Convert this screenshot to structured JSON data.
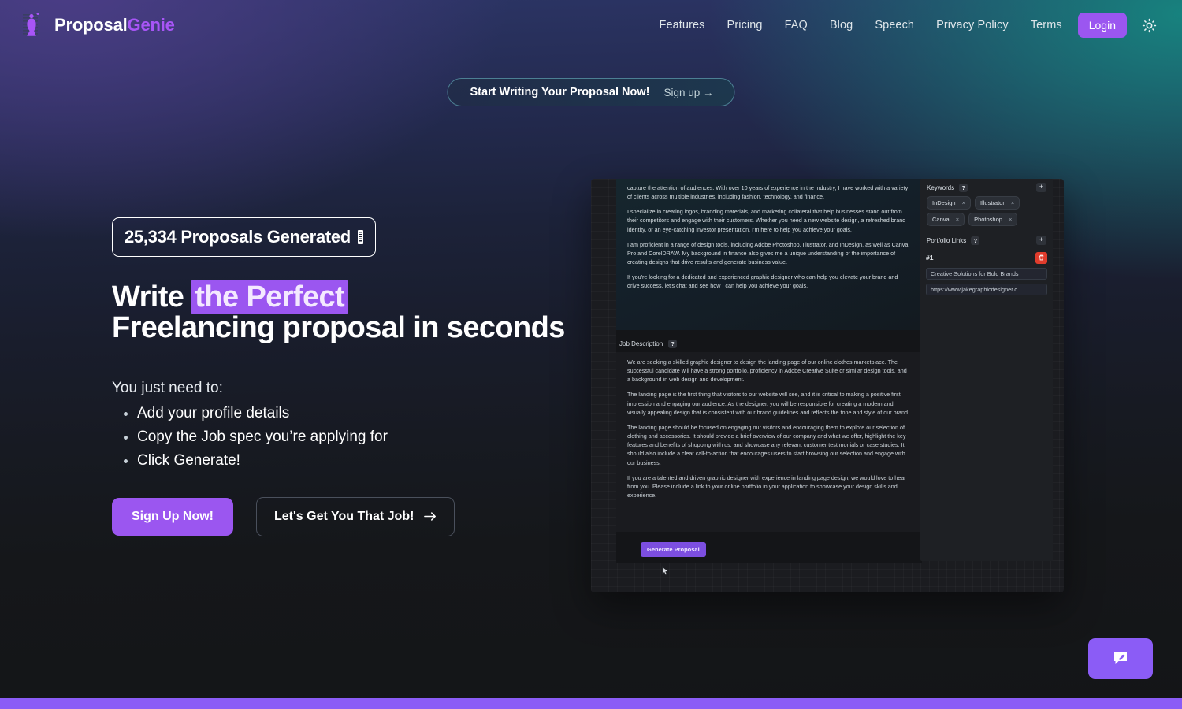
{
  "brand": {
    "word1": "Proposal",
    "word2": "Genie",
    "icon": "genie-lamp-icon"
  },
  "nav": {
    "links": [
      {
        "label": "Features"
      },
      {
        "label": "Pricing"
      },
      {
        "label": "FAQ"
      },
      {
        "label": "Blog"
      },
      {
        "label": "Speech"
      },
      {
        "label": "Privacy Policy"
      },
      {
        "label": "Terms"
      }
    ],
    "login_label": "Login",
    "theme_icon": "sun-icon"
  },
  "announcement": {
    "main": "Start Writing Your Proposal Now!",
    "cta": "Sign up →"
  },
  "hero": {
    "counter": {
      "value": "25,334",
      "label": "Proposals Generated",
      "icon": "counter-bar-icon"
    },
    "headline": {
      "line1_pre": "Write ",
      "line1_highlight": "the Perfect",
      "line2": "Freelancing proposal in seconds"
    },
    "need_title": "You just need to:",
    "need_items": [
      "Add your profile details",
      "Copy the Job spec you’re applying for",
      "Click Generate!"
    ],
    "primary_cta": "Sign Up Now!",
    "secondary_cta": "Let's Get You That Job!"
  },
  "app_shot": {
    "profile_paragraphs": [
      "capture the attention of audiences. With over 10 years of experience in the industry, I have worked with a variety of clients across multiple industries, including fashion, technology, and finance.",
      "I specialize in creating logos, branding materials, and marketing collateral that help businesses stand out from their competitors and engage with their customers. Whether you need a new website design, a refreshed brand identity, or an eye-catching investor presentation, I'm here to help you achieve your goals.",
      "I am proficient in a range of design tools, including Adobe Photoshop, Illustrator, and InDesign, as well as Canva Pro and CorelDRAW. My background in finance also gives me a unique understanding of the importance of creating designs that drive results and generate business value.",
      "If you're looking for a dedicated and experienced graphic designer who can help you elevate your brand and drive success, let's chat and see how I can help you achieve your goals."
    ],
    "job_description_label": "Job Description",
    "help_glyph": "?",
    "job_description_paragraphs": [
      "We are seeking a skilled graphic designer to design the landing page of our online clothes marketplace. The successful candidate will have a strong portfolio, proficiency in Adobe Creative Suite or similar design tools, and a background in web design and development.",
      "The landing page is the first thing that visitors to our website will see, and it is critical to making a positive first impression and engaging our audience. As the designer, you will be responsible for creating a modern and visually appealing design that is consistent with our brand guidelines and reflects the tone and style of our brand.",
      "The landing page should be focused on engaging our visitors and encouraging them to explore our selection of clothing and accessories. It should provide a brief overview of our company and what we offer, highlight the key features and benefits of shopping with us, and showcase any relevant customer testimonials or case studies. It should also include a clear call-to-action that encourages users to start browsing our selection and engage with our business.",
      "If you are a talented and driven graphic designer with experience in landing page design, we would love to hear from you. Please include a link to your online portfolio in your application to showcase your design skills and experience."
    ],
    "generate_button": "Generate Proposal",
    "sidebar": {
      "keywords_label": "Keywords",
      "keywords_add": "+",
      "keywords": [
        {
          "label": "InDesign",
          "remove": "×"
        },
        {
          "label": "Illustrator",
          "remove": "×"
        },
        {
          "label": "Canva",
          "remove": "×"
        },
        {
          "label": "Photoshop",
          "remove": "×"
        }
      ],
      "portfolio_label": "Portfolio Links",
      "portfolio_add": "+",
      "portfolio_index": "#1",
      "portfolio_title": "Creative Solutions for Bold Brands",
      "portfolio_url": "https://www.jakegraphicdesigner.c"
    }
  },
  "chat": {
    "icon": "chat-edit-icon"
  },
  "colors": {
    "accent_purple": "#9b56f0",
    "fab_purple": "#8b5cf6",
    "delete_red": "#e03c2c",
    "announce_border": "#4c7f93"
  }
}
